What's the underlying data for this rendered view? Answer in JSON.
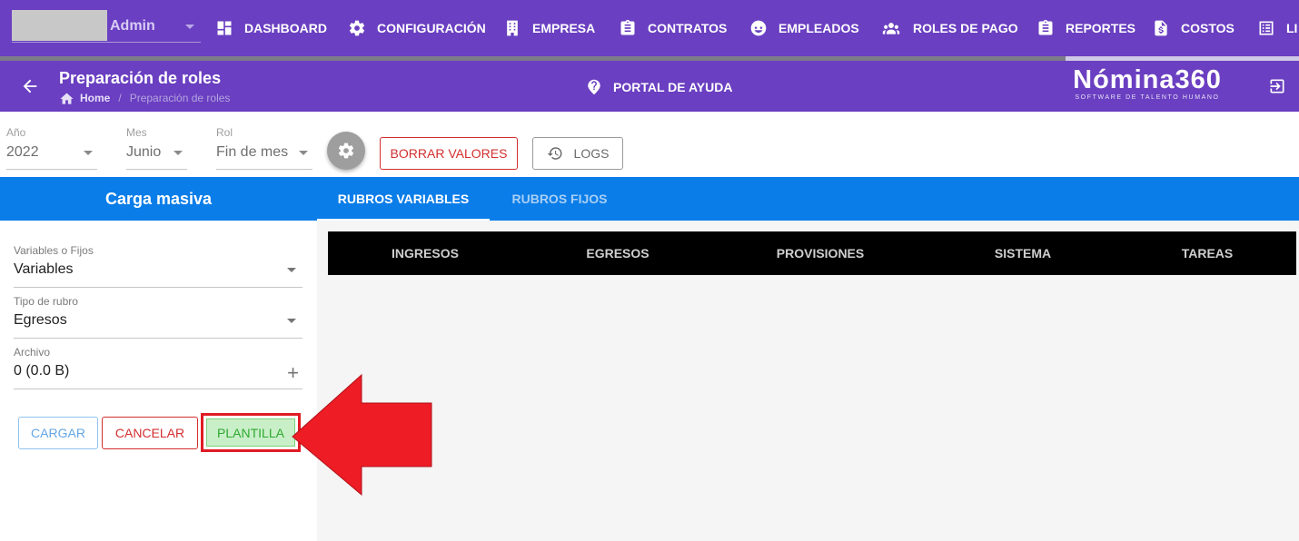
{
  "user": {
    "name": "Admin"
  },
  "nav": {
    "items": [
      {
        "label": "DASHBOARD",
        "icon": "dashboard-icon"
      },
      {
        "label": "CONFIGURACIÓN",
        "icon": "gear-icon"
      },
      {
        "label": "EMPRESA",
        "icon": "building-icon"
      },
      {
        "label": "CONTRATOS",
        "icon": "clipboard-icon"
      },
      {
        "label": "EMPLEADOS",
        "icon": "face-icon"
      },
      {
        "label": "ROLES DE PAGO",
        "icon": "people-icon"
      },
      {
        "label": "REPORTES",
        "icon": "clipboard-icon"
      },
      {
        "label": "COSTOS",
        "icon": "dollar-file-icon"
      },
      {
        "label": "LI",
        "icon": "list-icon"
      }
    ],
    "progress_fraction": 0.82
  },
  "header": {
    "title": "Preparación de roles",
    "breadcrumb_home": "Home",
    "breadcrumb_separator": "/",
    "breadcrumb_current": "Preparación de roles",
    "help_label": "PORTAL DE AYUDA",
    "brand_name": "Nómina360",
    "brand_tagline": "SOFTWARE DE TALENTO HUMANO"
  },
  "filters": {
    "year": {
      "label": "Año",
      "value": "2022"
    },
    "month": {
      "label": "Mes",
      "value": "Junio"
    },
    "role": {
      "label": "Rol",
      "value": "Fin de mes"
    }
  },
  "toolbar": {
    "clear_label": "BORRAR VALORES",
    "logs_label": "LOGS"
  },
  "upload_panel": {
    "title": "Carga masiva",
    "type_label": "Variables o Fijos",
    "type_value": "Variables",
    "category_label": "Tipo de rubro",
    "category_value": "Egresos",
    "file_label": "Archivo",
    "file_value": "0 (0.0 B)",
    "load_label": "CARGAR",
    "cancel_label": "CANCELAR",
    "template_label": "PLANTILLA"
  },
  "tabs": [
    {
      "label": "RUBROS VARIABLES",
      "active": true
    },
    {
      "label": "RUBROS FIJOS",
      "active": false
    }
  ],
  "subtabs": [
    "INGRESOS",
    "EGRESOS",
    "PROVISIONES",
    "SISTEMA",
    "TAREAS"
  ],
  "colors": {
    "nav_purple": "#6a3fc1",
    "primary_blue": "#0a7de8",
    "danger_red": "#d32f2f",
    "annotation_red": "#e01b24",
    "success_green": "#2fa82f"
  }
}
